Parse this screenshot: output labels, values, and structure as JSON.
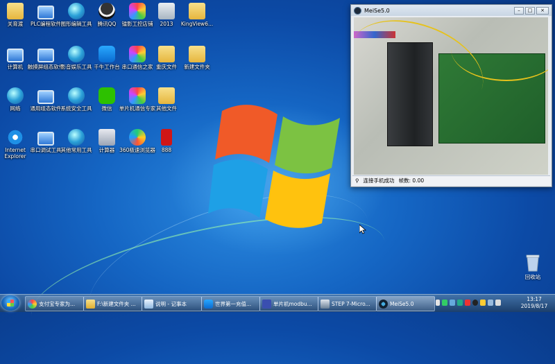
{
  "desktop": {
    "icons": [
      {
        "label": "关育渡",
        "icon": "folder-icon"
      },
      {
        "label": "PLC编程软件",
        "icon": "computer-icon"
      },
      {
        "label": "图形编辑工具",
        "icon": "globe-icon"
      },
      {
        "label": "腾讯QQ",
        "icon": "qq-penguin-icon"
      },
      {
        "label": "镭影工控店铺",
        "icon": "color-app-icon"
      },
      {
        "label": "2013",
        "icon": "recycle-icon"
      },
      {
        "label": "KingView6...",
        "icon": "folder-icon"
      },
      {
        "label": "计算机",
        "icon": "computer-icon"
      },
      {
        "label": "触摸屏组态软件",
        "icon": "computer-icon"
      },
      {
        "label": "影音娱乐工具",
        "icon": "globe-icon"
      },
      {
        "label": "千牛工作台",
        "icon": "qianniu-icon"
      },
      {
        "label": "串口通信之家",
        "icon": "color-app-icon"
      },
      {
        "label": "重庆文件",
        "icon": "folder-icon"
      },
      {
        "label": "新建文件夹",
        "icon": "folder-icon"
      },
      {
        "label": "网络",
        "icon": "network-icon"
      },
      {
        "label": "通用组态软件",
        "icon": "computer-icon"
      },
      {
        "label": "系统安全工具",
        "icon": "globe-icon"
      },
      {
        "label": "微信",
        "icon": "wechat-icon"
      },
      {
        "label": "单片机通信专家",
        "icon": "color-app-icon"
      },
      {
        "label": "其他文件",
        "icon": "folder-icon"
      },
      {
        "label": "Internet Explorer",
        "icon": "ie-icon"
      },
      {
        "label": "串口调试工具",
        "icon": "computer-icon"
      },
      {
        "label": "其他常用工具",
        "icon": "globe-icon"
      },
      {
        "label": "计算器",
        "icon": "calculator-icon"
      },
      {
        "label": "360极速浏览器",
        "icon": "browser-360-icon"
      },
      {
        "label": "888",
        "icon": "red-envelope-icon"
      }
    ],
    "recycle_bin": "回收站"
  },
  "meise_window": {
    "title": "MeiSe5.0",
    "status_connect": "连接手机成功",
    "status_fps": "帧数: 0.00"
  },
  "taskbar": {
    "items": [
      {
        "label": "支付宝专家为..."
      },
      {
        "label": "F:\\新建文件夹 ..."
      },
      {
        "label": "说明 - 记事本"
      },
      {
        "label": "世界第一充值..."
      },
      {
        "label": "单片机modbu..."
      },
      {
        "label": "STEP 7-Micro..."
      },
      {
        "label": "MeiSe5.0"
      }
    ],
    "time": "13:17",
    "date": "2019/8/17"
  }
}
